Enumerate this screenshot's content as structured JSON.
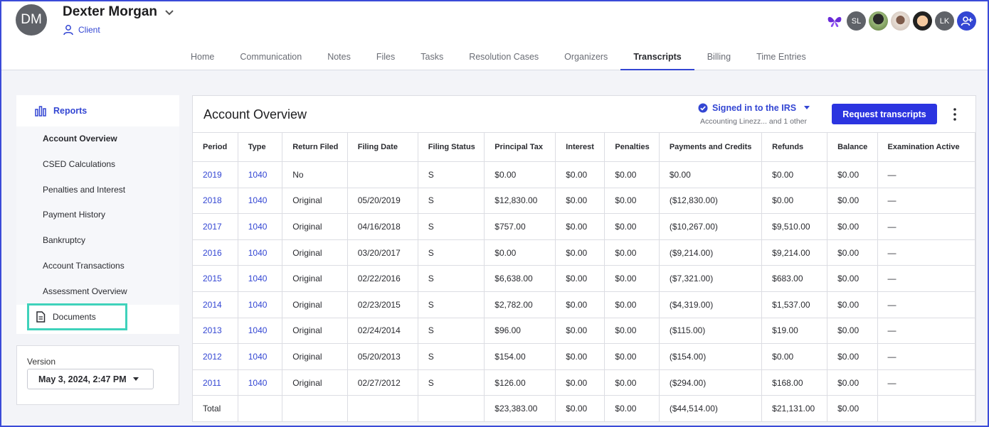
{
  "client": {
    "initials": "DM",
    "name": "Dexter Morgan",
    "role": "Client"
  },
  "header_icons": {
    "user_icon": "person-icon",
    "chevron": "chevron-down-icon"
  },
  "tabs": [
    {
      "label": "Home"
    },
    {
      "label": "Communication"
    },
    {
      "label": "Notes"
    },
    {
      "label": "Files"
    },
    {
      "label": "Tasks"
    },
    {
      "label": "Resolution Cases"
    },
    {
      "label": "Organizers"
    },
    {
      "label": "Transcripts",
      "active": true
    },
    {
      "label": "Billing"
    },
    {
      "label": "Time Entries"
    }
  ],
  "team": {
    "butterfly": "butterfly-icon",
    "sl": "SL",
    "lk": "LK",
    "add_user": "add-user-icon"
  },
  "sidebar": {
    "header": "Reports",
    "items": [
      {
        "label": "Account Overview",
        "active": true
      },
      {
        "label": "CSED Calculations"
      },
      {
        "label": "Penalties and Interest"
      },
      {
        "label": "Payment History"
      },
      {
        "label": "Bankruptcy"
      },
      {
        "label": "Account Transactions"
      },
      {
        "label": "Assessment Overview"
      }
    ],
    "documents": "Documents"
  },
  "version": {
    "label": "Version",
    "value": "May 3, 2024, 2:47 PM"
  },
  "panel": {
    "title": "Account Overview",
    "irs_status": "Signed in to the IRS",
    "irs_account": "Accounting Linezz... and 1 other",
    "request_button": "Request transcripts"
  },
  "table": {
    "headers": [
      "Period",
      "Type",
      "Return Filed",
      "Filing Date",
      "Filing Status",
      "Principal Tax",
      "Interest",
      "Penalties",
      "Payments and Credits",
      "Refunds",
      "Balance",
      "Examination Active"
    ],
    "rows": [
      [
        "2019",
        "1040",
        "No",
        "",
        "S",
        "$0.00",
        "$0.00",
        "$0.00",
        "$0.00",
        "$0.00",
        "$0.00",
        "—"
      ],
      [
        "2018",
        "1040",
        "Original",
        "05/20/2019",
        "S",
        "$12,830.00",
        "$0.00",
        "$0.00",
        "($12,830.00)",
        "$0.00",
        "$0.00",
        "—"
      ],
      [
        "2017",
        "1040",
        "Original",
        "04/16/2018",
        "S",
        "$757.00",
        "$0.00",
        "$0.00",
        "($10,267.00)",
        "$9,510.00",
        "$0.00",
        "—"
      ],
      [
        "2016",
        "1040",
        "Original",
        "03/20/2017",
        "S",
        "$0.00",
        "$0.00",
        "$0.00",
        "($9,214.00)",
        "$9,214.00",
        "$0.00",
        "—"
      ],
      [
        "2015",
        "1040",
        "Original",
        "02/22/2016",
        "S",
        "$6,638.00",
        "$0.00",
        "$0.00",
        "($7,321.00)",
        "$683.00",
        "$0.00",
        "—"
      ],
      [
        "2014",
        "1040",
        "Original",
        "02/23/2015",
        "S",
        "$2,782.00",
        "$0.00",
        "$0.00",
        "($4,319.00)",
        "$1,537.00",
        "$0.00",
        "—"
      ],
      [
        "2013",
        "1040",
        "Original",
        "02/24/2014",
        "S",
        "$96.00",
        "$0.00",
        "$0.00",
        "($115.00)",
        "$19.00",
        "$0.00",
        "—"
      ],
      [
        "2012",
        "1040",
        "Original",
        "05/20/2013",
        "S",
        "$154.00",
        "$0.00",
        "$0.00",
        "($154.00)",
        "$0.00",
        "$0.00",
        "—"
      ],
      [
        "2011",
        "1040",
        "Original",
        "02/27/2012",
        "S",
        "$126.00",
        "$0.00",
        "$0.00",
        "($294.00)",
        "$168.00",
        "$0.00",
        "—"
      ]
    ],
    "total": [
      "Total",
      "",
      "",
      "",
      "",
      "$23,383.00",
      "$0.00",
      "$0.00",
      "($44,514.00)",
      "$21,131.00",
      "$0.00",
      ""
    ]
  },
  "colors": {
    "accent": "#3346d3",
    "button": "#2b34e0",
    "highlight": "#3fd2bb"
  }
}
